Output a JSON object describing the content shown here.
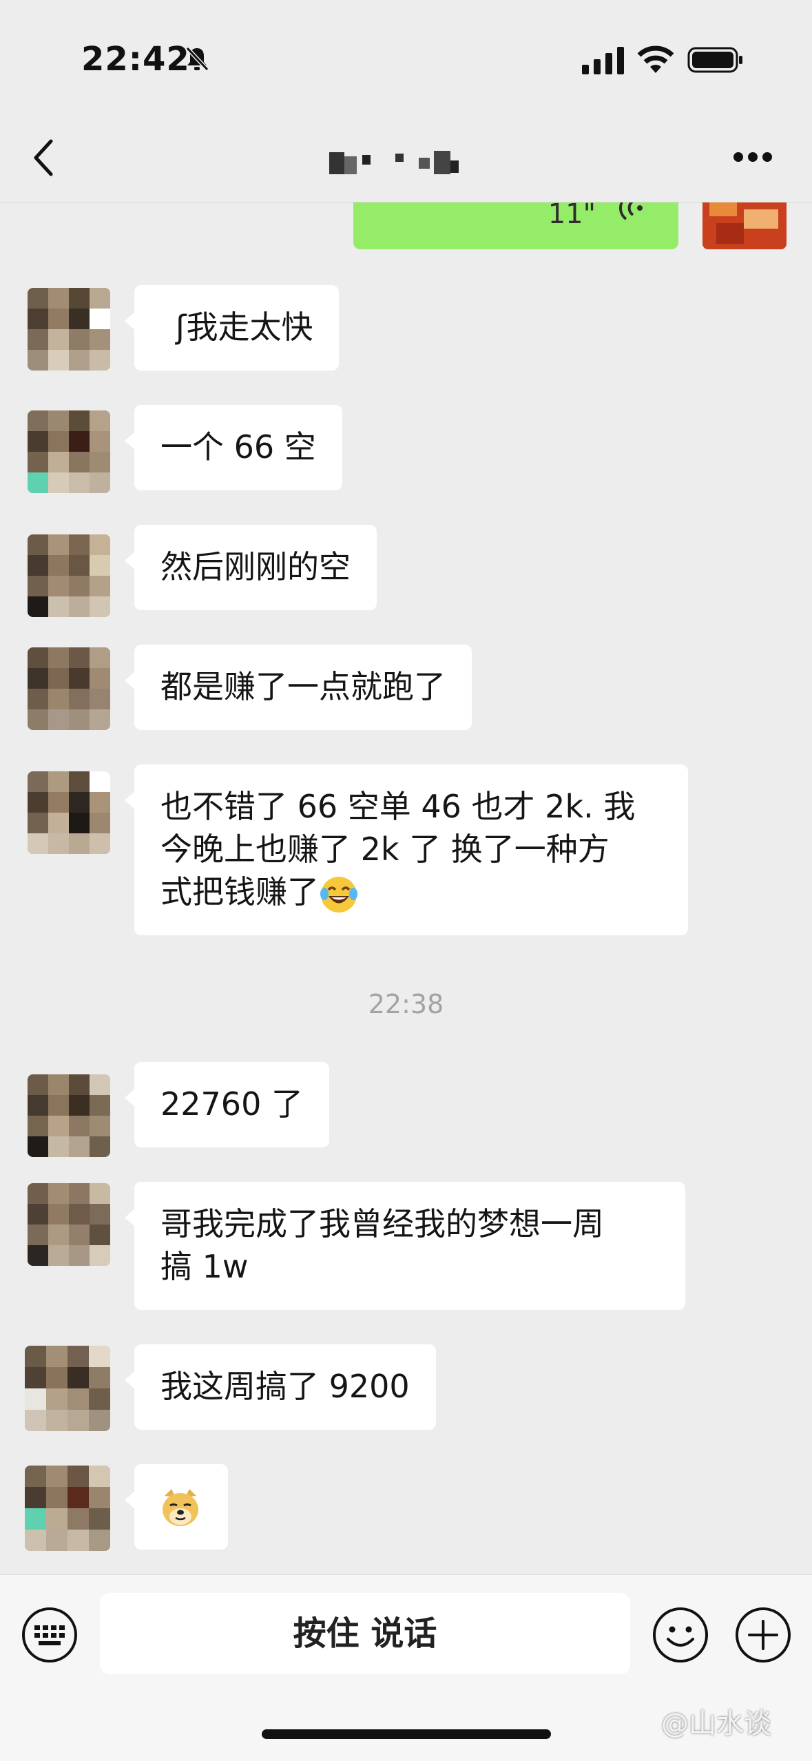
{
  "status_bar": {
    "time": "22:42"
  },
  "nav": {
    "back_icon": "chevron-left-icon",
    "more_icon": "ellipsis-icon"
  },
  "messages": [
    {
      "text": "ʃ我走太快"
    },
    {
      "text": "一个 66 空"
    },
    {
      "text": "然后刚刚的空"
    },
    {
      "text": "都是赚了一点就跑了"
    },
    {
      "line1": "也不错了 66 空单 46 也才 2k. 我",
      "line2": "今晚上也赚了 2k 了   换了一种方",
      "line3": "式把钱赚了"
    },
    {
      "text": "22760 了"
    },
    {
      "line1": "哥我完成了我曾经我的梦想一周",
      "line2": "搞 1w"
    },
    {
      "text": "我这周搞了 9200"
    }
  ],
  "timestamp": "22:38",
  "sent_voice": {
    "duration": "11\""
  },
  "input_bar": {
    "hold_to_talk": "按住 说话"
  },
  "watermark": "@山水谈",
  "colors": {
    "background": "#ededed",
    "sent_bubble": "#95ec69",
    "received_bubble": "#ffffff"
  }
}
